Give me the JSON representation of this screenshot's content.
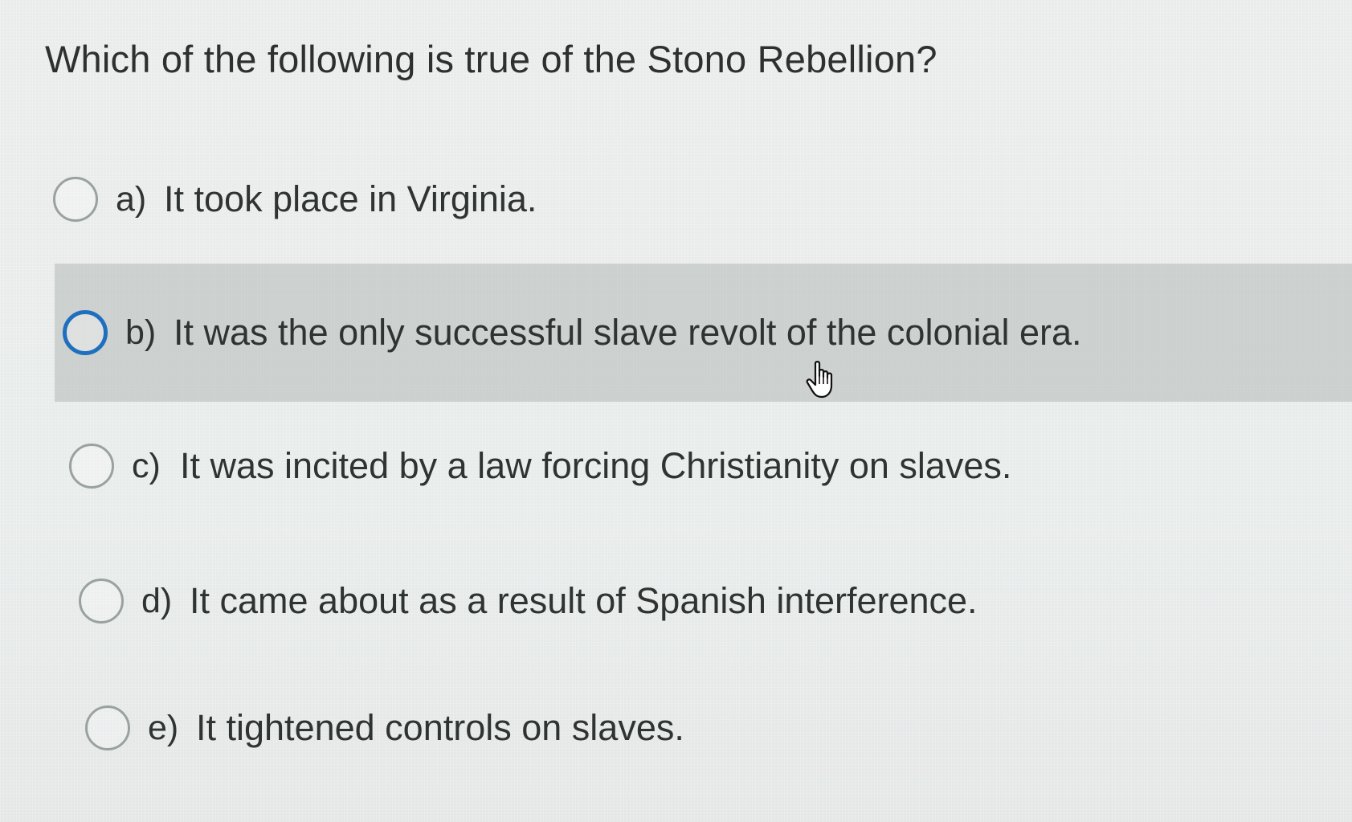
{
  "question": {
    "text": "Which of the following is true of the Stono Rebellion?"
  },
  "options": [
    {
      "letter": "a)",
      "text": "It took place in Virginia.",
      "hovered": false
    },
    {
      "letter": "b)",
      "text": "It was the only successful slave revolt of the colonial era.",
      "hovered": true
    },
    {
      "letter": "c)",
      "text": "It was incited by a law forcing Christianity on slaves.",
      "hovered": false
    },
    {
      "letter": "d)",
      "text": "It came about as a result of Spanish interference.",
      "hovered": false
    },
    {
      "letter": "e)",
      "text": "It tightened controls on slaves.",
      "hovered": false
    }
  ],
  "colors": {
    "background": "#eaeceb",
    "highlight": "#c4c9c7",
    "radio_focus": "#1f6fbf",
    "text": "#2f3433"
  },
  "icons": {
    "cursor": "hand-pointer-icon"
  }
}
